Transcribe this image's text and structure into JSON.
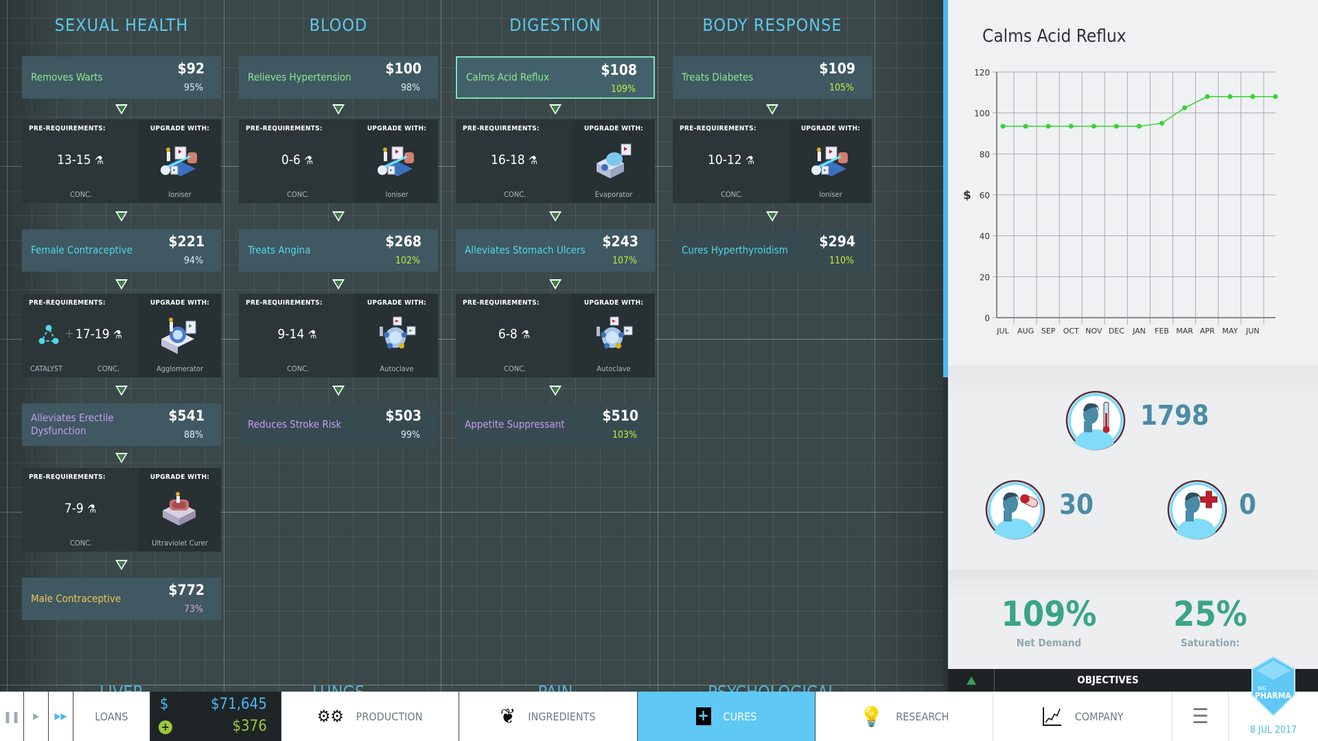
{
  "columns": [
    {
      "header": "SEXUAL HEALTH",
      "cures": [
        {
          "name": "Removes Warts",
          "price": "$92",
          "pct": "95%",
          "researched": true
        },
        {
          "name": "Female Contraceptive",
          "price": "$221",
          "pct": "94%",
          "researched": true
        },
        {
          "name": "Alleviates Erectile Dysfunction",
          "price": "$541",
          "pct": "88%",
          "researched": true
        },
        {
          "name": "Male Contraceptive",
          "price": "$772",
          "pct": "73%",
          "researched": true
        }
      ],
      "upgrades": [
        {
          "req": "13-15",
          "catalyst": false,
          "machine": "Ioniser"
        },
        {
          "req": "17-19",
          "catalyst": true,
          "machine": "Agglomerator"
        },
        {
          "req": "7-9",
          "catalyst": false,
          "machine": "Ultraviolet Curer"
        }
      ]
    },
    {
      "header": "BLOOD",
      "cures": [
        {
          "name": "Relieves Hypertension",
          "price": "$100",
          "pct": "98%",
          "researched": true
        },
        {
          "name": "Treats Angina",
          "price": "$268",
          "pct": "102%",
          "researched": true
        },
        {
          "name": "Reduces Stroke Risk",
          "price": "$503",
          "pct": "99%",
          "researched": false
        }
      ],
      "upgrades": [
        {
          "req": "0-6",
          "catalyst": false,
          "machine": "Ioniser"
        },
        {
          "req": "9-14",
          "catalyst": false,
          "machine": "Autoclave"
        }
      ]
    },
    {
      "header": "DIGESTION",
      "cures": [
        {
          "name": "Calms Acid Reflux",
          "price": "$108",
          "pct": "109%",
          "researched": true,
          "selected": true
        },
        {
          "name": "Alleviates Stomach Ulcers",
          "price": "$243",
          "pct": "107%",
          "researched": true
        },
        {
          "name": "Appetite Suppressant",
          "price": "$510",
          "pct": "103%",
          "researched": false
        }
      ],
      "upgrades": [
        {
          "req": "16-18",
          "catalyst": false,
          "machine": "Evaporator"
        },
        {
          "req": "6-8",
          "catalyst": false,
          "machine": "Autoclave"
        }
      ]
    },
    {
      "header": "BODY RESPONSE",
      "cures": [
        {
          "name": "Treats Diabetes",
          "price": "$109",
          "pct": "105%",
          "researched": true
        },
        {
          "name": "Cures Hyperthyroidism",
          "price": "$294",
          "pct": "110%",
          "researched": false
        }
      ],
      "upgrades": [
        {
          "req": "10-12",
          "catalyst": false,
          "machine": "Ioniser"
        }
      ]
    }
  ],
  "labels": {
    "pre": "PRE-REQUIREMENTS:",
    "upgrade": "UPGRADE WITH:",
    "conc": "CONC.",
    "catalyst": "CATALYST"
  },
  "lower_headers": [
    "LIVER",
    "LUNGS",
    "PAIN",
    "PSYCHOLOGICAL"
  ],
  "tier_colors": [
    "#8ee88e",
    "#4fd8e8",
    "#c99af0",
    "#f0c850"
  ],
  "chart_data": {
    "type": "line",
    "title": "Calms Acid Reflux",
    "ylabel": "$",
    "xlabel": "",
    "categories": [
      "JUL",
      "AUG",
      "SEP",
      "OCT",
      "NOV",
      "DEC",
      "JAN",
      "FEB",
      "MAR",
      "APR",
      "MAY",
      "JUN",
      ""
    ],
    "values": [
      93.5,
      93.5,
      93.5,
      93.5,
      93.5,
      93.5,
      93.5,
      95,
      102.5,
      108,
      108,
      108,
      108
    ],
    "ylim": [
      0,
      120
    ],
    "yticks": [
      0,
      20,
      40,
      60,
      80,
      100,
      120
    ],
    "grid": true,
    "color": "#33d433"
  },
  "stats": {
    "sick": "1798",
    "treated": "30",
    "cured": "0",
    "net_demand": "109%",
    "net_demand_label": "Net Demand",
    "saturation": "25%",
    "saturation_label": "Saturation:"
  },
  "objectives": "OBJECTIVES",
  "bottom": {
    "loans": "LOANS",
    "money_symbol": "$",
    "money": "$71,645",
    "income": "$376",
    "production": "PRODUCTION",
    "ingredients": "INGREDIENTS",
    "cures": "CURES",
    "research": "RESEARCH",
    "company": "COMPANY",
    "date": "8 JUL 2017",
    "logo_small": "BIG",
    "logo": "PHARMA",
    "active_tab": "cures"
  }
}
